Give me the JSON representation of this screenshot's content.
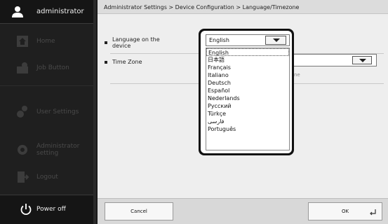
{
  "sidebar": {
    "user_name": "administrator",
    "items": [
      {
        "label": "Home",
        "icon": "home-icon"
      },
      {
        "label": "Job Button",
        "icon": "job-button-icon"
      },
      {
        "label": "User Settings",
        "icon": "user-settings-icon"
      },
      {
        "label": "Administrator setting",
        "icon": "administrator-setting-icon"
      },
      {
        "label": "Logout",
        "icon": "logout-icon"
      }
    ],
    "power_label": "Power off"
  },
  "breadcrumb": "Administrator Settings > Device Configuration > Language/Timezone",
  "settings": {
    "language_label": "Language on the device",
    "timezone_label": "Time Zone",
    "timezone_hint": "ne"
  },
  "language_dropdown": {
    "current": "English",
    "options": [
      "English",
      "日本語",
      "Français",
      "Italiano",
      "Deutsch",
      "Español",
      "Nederlands",
      "Русский",
      "Türkçe",
      "فارسی",
      "Português"
    ],
    "selected_index": 0
  },
  "buttons": {
    "cancel": "Cancel",
    "ok": "OK"
  },
  "colors": {
    "sidebar_bg": "#1f1f1f",
    "main_bg": "#eeeeee",
    "popup_frame": "#111111"
  }
}
